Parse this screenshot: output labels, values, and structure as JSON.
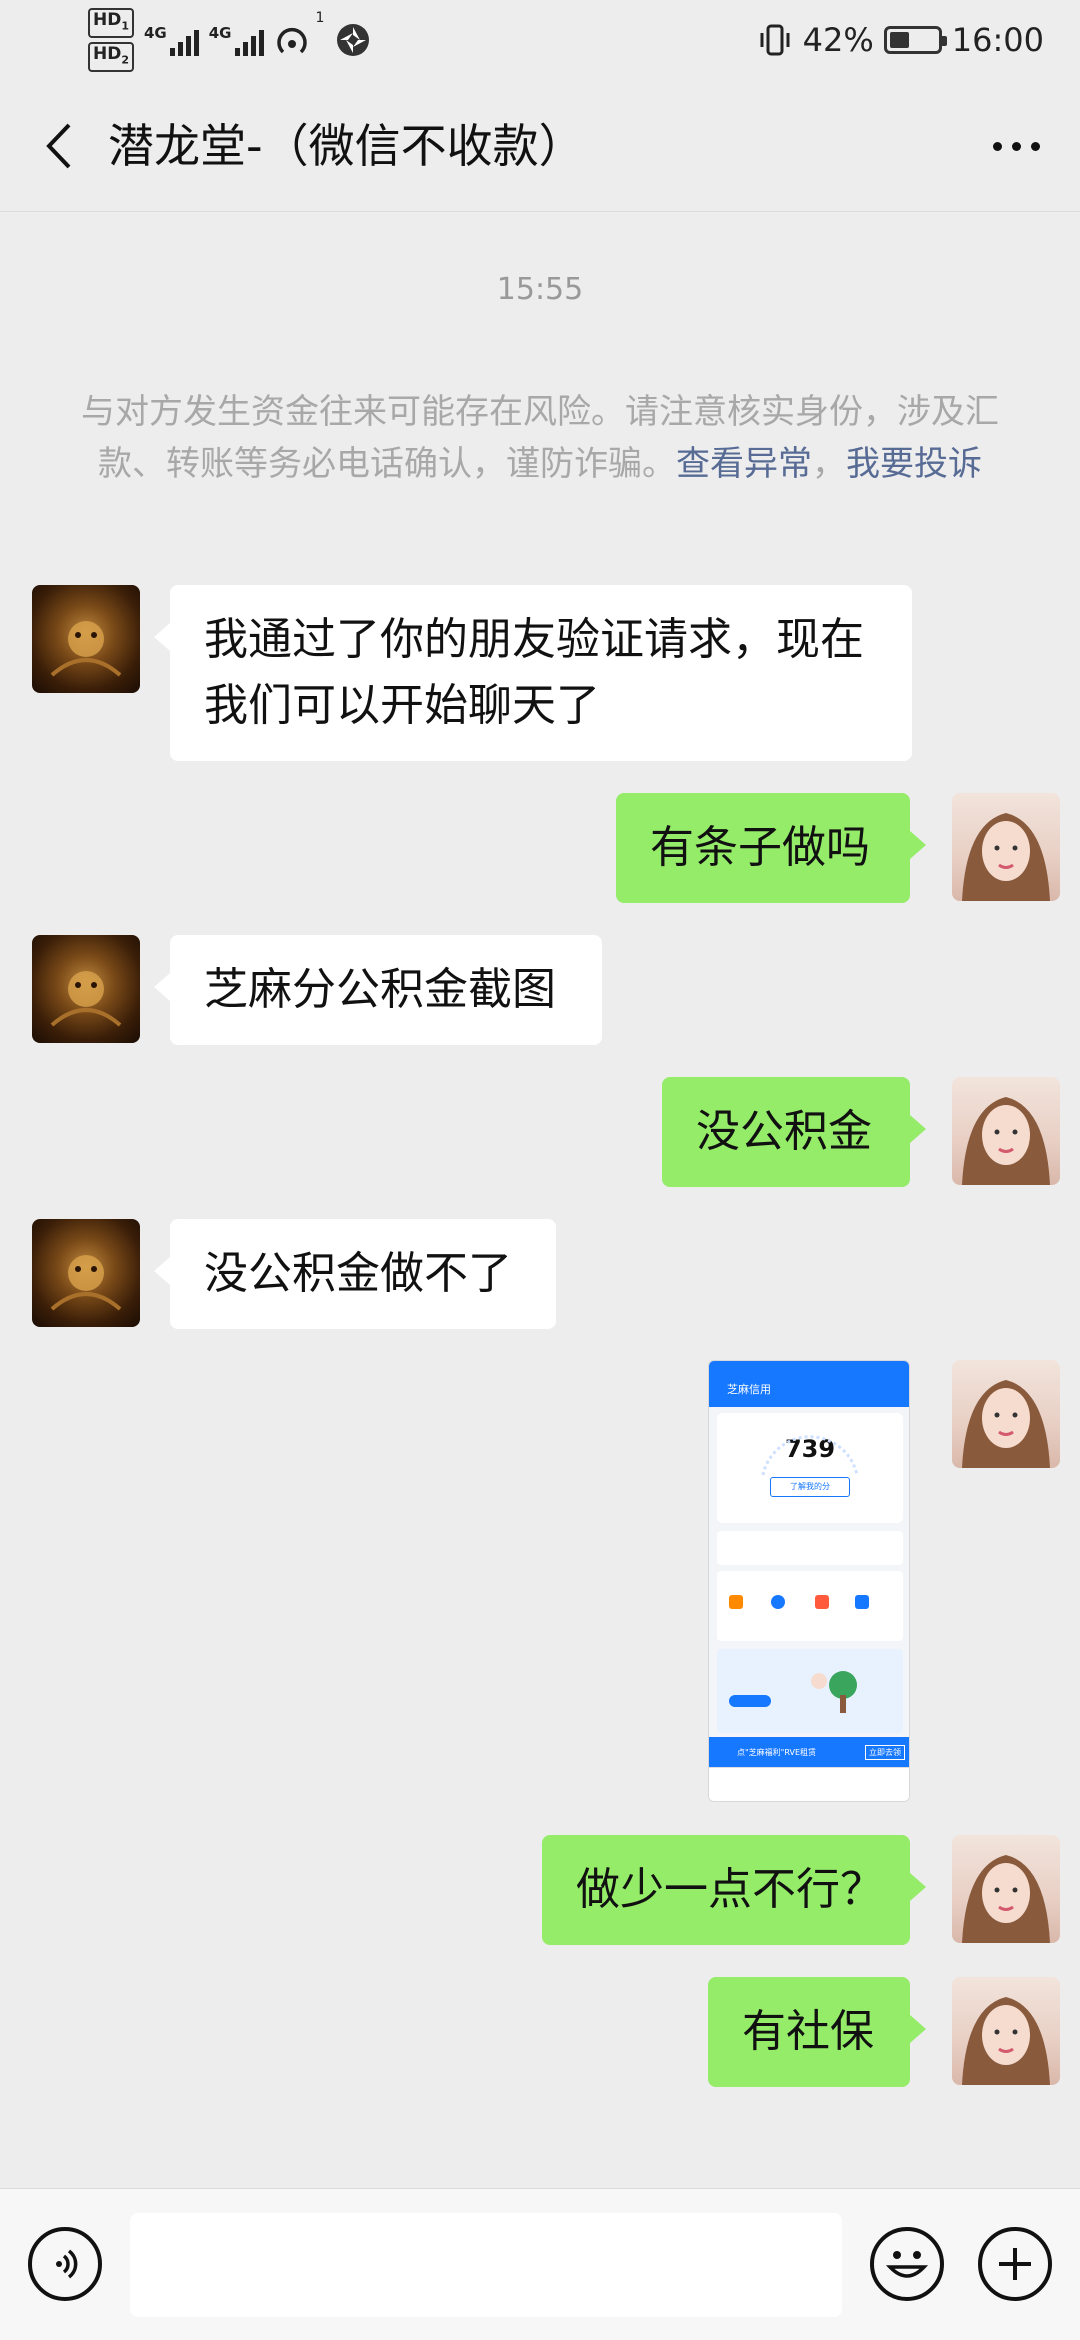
{
  "status_bar": {
    "hd1": "HD",
    "hd1_sub": "1",
    "hd2": "HD",
    "hd2_sub": "2",
    "net1": "4G",
    "net2": "4G",
    "hotspot_sup": "1",
    "battery_percent": "42%",
    "battery_level": 0.42,
    "time": "16:00"
  },
  "header": {
    "title": "潜龙堂-（微信不收款）"
  },
  "chat": {
    "timestamp": "15:55",
    "warning_text": "与对方发生资金往来可能存在风险。请注意核实身份，涉及汇款、转账等务必电话确认，谨防诈骗。",
    "warning_link1": "查看异常",
    "warning_sep": "，",
    "warning_link2": "我要投诉",
    "messages": [
      {
        "side": "left",
        "text": "我通过了你的朋友验证请求，现在我们可以开始聊天了"
      },
      {
        "side": "right",
        "text": "有条子做吗"
      },
      {
        "side": "left",
        "text": "芝麻分公积金截图"
      },
      {
        "side": "right",
        "text": "没公积金"
      },
      {
        "side": "left",
        "text": "没公积金做不了"
      },
      {
        "side": "right",
        "type": "image",
        "caption": "芝麻信用",
        "score": "739",
        "button": "了解我的分",
        "banner": "点\"芝麻福利\"RVE租赁",
        "banner_btn": "立即去领"
      },
      {
        "side": "right",
        "text": "做少一点不行？"
      },
      {
        "side": "right",
        "text": "有社保"
      }
    ]
  },
  "icons": {
    "back": "chevron-left-icon",
    "more": "more-dots-icon",
    "voice": "voice-icon",
    "emoji": "emoji-icon",
    "plus": "plus-icon"
  },
  "colors": {
    "background": "#ededed",
    "bubble_right": "#95ec69",
    "bubble_left": "#ffffff",
    "link": "#576b95"
  }
}
